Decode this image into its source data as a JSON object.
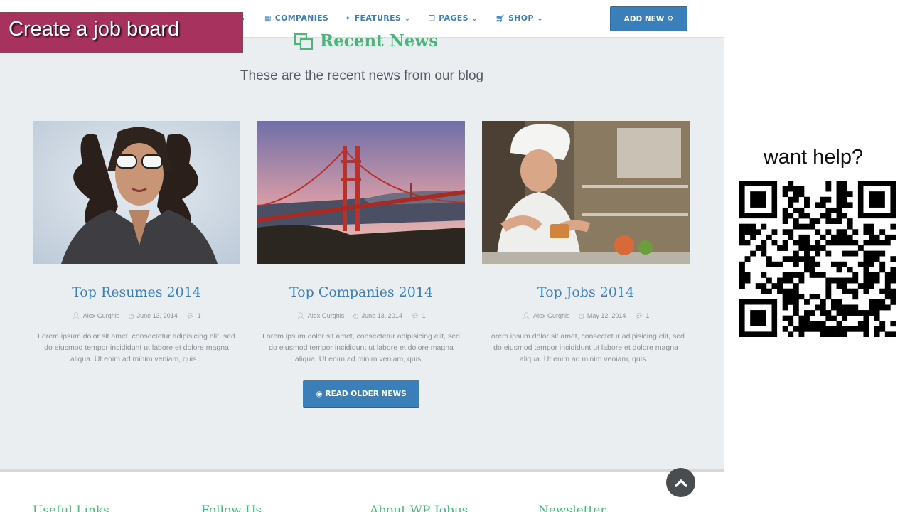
{
  "overlay": {
    "title": "Create a job board"
  },
  "nav": {
    "items": [
      {
        "label": "COMPANIES",
        "icon": "building-icon"
      },
      {
        "label": "FEATURES",
        "icon": "star-icon"
      },
      {
        "label": "PAGES",
        "icon": "copy-icon"
      },
      {
        "label": "SHOP",
        "icon": "cart-icon"
      }
    ],
    "partial_label": "S",
    "add_new_label": "ADD NEW"
  },
  "section": {
    "title": "Recent News",
    "subtitle": "These are the recent news from our blog"
  },
  "posts": [
    {
      "title": "Top Resumes 2014",
      "author": "Alex Gurghis",
      "date": "June 13, 2014",
      "comments": "1",
      "excerpt": "Lorem ipsum dolor sit amet, consectetur adipisicing elit, sed do eiusmod tempor incididunt ut labore et dolore magna aliqua. Ut enim ad minim veniam, quis...",
      "image": "woman-sunglasses-photo"
    },
    {
      "title": "Top Companies 2014",
      "author": "Alex Gurghis",
      "date": "June 13, 2014",
      "comments": "1",
      "excerpt": "Lorem ipsum dolor sit amet, consectetur adipisicing elit, sed do eiusmod tempor incididunt ut labore et dolore magna aliqua. Ut enim ad minim veniam, quis...",
      "image": "golden-gate-bridge-photo"
    },
    {
      "title": "Top Jobs 2014",
      "author": "Alex Gurghis",
      "date": "May 12, 2014",
      "comments": "1",
      "excerpt": "Lorem ipsum dolor sit amet, consectetur adipisicing elit, sed do eiusmod tempor incididunt ut labore et dolore magna aliqua. Ut enim ad minim veniam, quis...",
      "image": "chef-cooking-photo"
    }
  ],
  "read_older_label": "READ OLDER NEWS",
  "footer": {
    "headings": [
      "Useful Links",
      "Follow Us",
      "About WP Jobus",
      "Newsletter"
    ]
  },
  "help": {
    "text": "want help?"
  },
  "colors": {
    "accent_blue": "#3a7fba",
    "accent_green": "#4cb57a",
    "badge": "#a6325d",
    "page_bg": "#ebeef1"
  }
}
